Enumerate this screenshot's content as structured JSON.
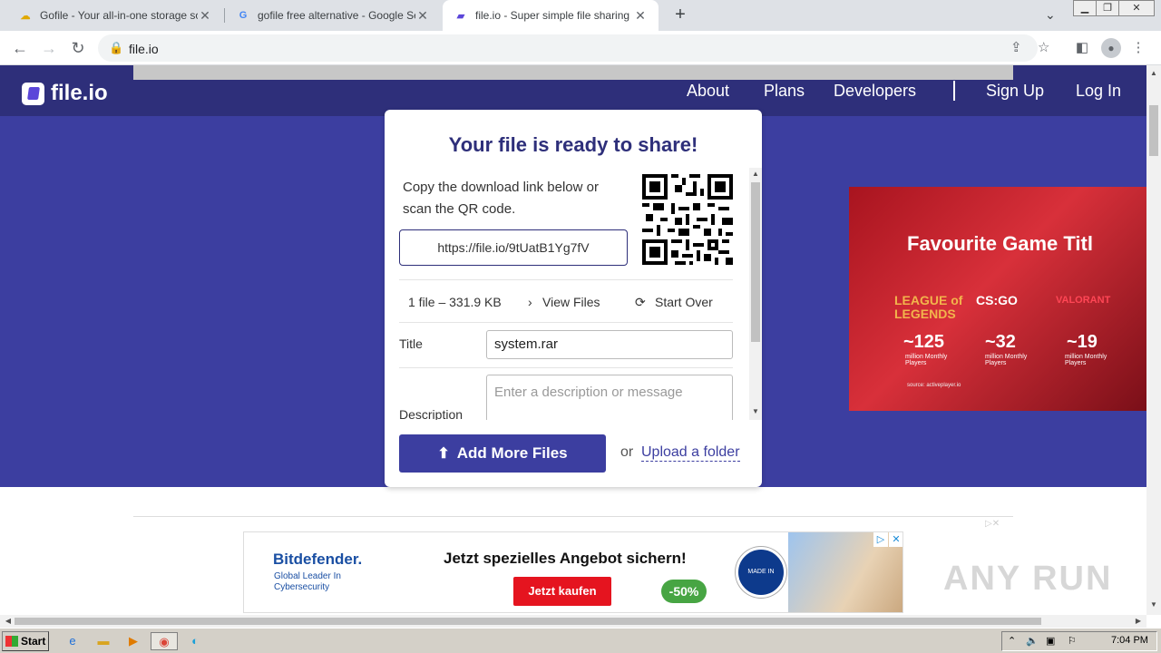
{
  "browser": {
    "tabs": [
      {
        "title": "Gofile - Your all-in-one storage soluti",
        "favicon": "gofile-icon",
        "active": false
      },
      {
        "title": "gofile free alternative - Google Search",
        "favicon": "google-icon",
        "active": false
      },
      {
        "title": "file.io - Super simple file sharing",
        "favicon": "fileio-icon",
        "active": true
      }
    ],
    "url": "file.io"
  },
  "site": {
    "logo": "file.io",
    "nav": [
      "About",
      "Plans",
      "Developers",
      "Sign Up",
      "Log In"
    ]
  },
  "card": {
    "title": "Your file is ready to share!",
    "copy_text": "Copy the download link below or scan the QR code.",
    "link": "https://file.io/9tUatB1Yg7fV",
    "file_info": "1 file – 331.9 KB",
    "view_files": "View Files",
    "start_over": "Start Over",
    "title_label": "Title",
    "title_value": "system.rar",
    "description_label": "Description",
    "description_placeholder": "Enter a description or message",
    "add_more": "Add More Files",
    "or": "or",
    "upload_folder": "Upload a folder"
  },
  "ad_game": {
    "title": "Favourite Game Titl",
    "games": [
      {
        "name": "LEAGUE of LEGENDS",
        "value": "~125",
        "sub": "million Monthly Players"
      },
      {
        "name": "CS:GO",
        "value": "~32",
        "sub": "million Monthly Players"
      },
      {
        "name": "VALORANT",
        "value": "~19",
        "sub": "million Monthly Players"
      }
    ],
    "source": "source: activeplayer.io"
  },
  "ad_bitdefender": {
    "brand": "Bitdefender.",
    "tagline": "Global Leader In Cybersecurity",
    "headline": "Jetzt spezielles Angebot sichern!",
    "cta": "Jetzt kaufen",
    "discount": "-50%",
    "badge": "MADE IN EUROPE"
  },
  "watermark": "ANY RUN",
  "taskbar": {
    "start": "Start",
    "time": "7:04 PM"
  }
}
